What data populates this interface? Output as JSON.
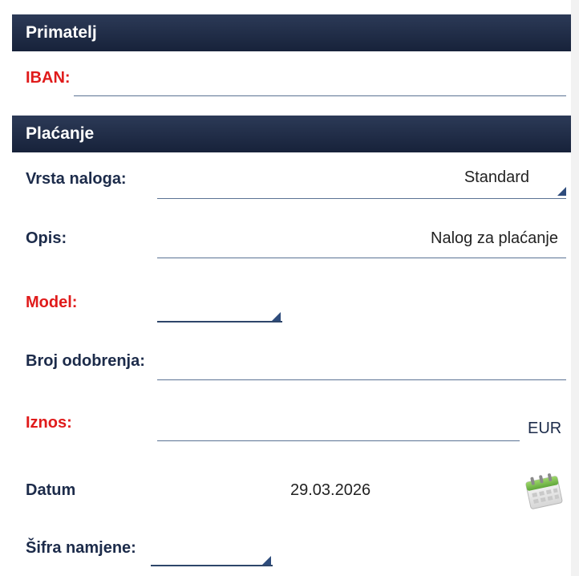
{
  "sections": {
    "primatelj_title": "Primatelj",
    "placanje_title": "Plaćanje"
  },
  "fields": {
    "iban": {
      "label": "IBAN:",
      "value": ""
    },
    "vrsta_naloga": {
      "label": "Vrsta naloga:",
      "value": "Standard"
    },
    "opis": {
      "label": "Opis:",
      "value": "Nalog za plaćanje"
    },
    "model": {
      "label": "Model:",
      "value": ""
    },
    "broj_odobrenja": {
      "label": "Broj odobrenja:",
      "value": ""
    },
    "iznos": {
      "label": "Iznos:",
      "value": "",
      "currency": "EUR"
    },
    "datum": {
      "label": "Datum",
      "value": "29.03.2026",
      "icon": "calendar-icon"
    },
    "sifra_namjene": {
      "label": "Šifra namjene:",
      "value": ""
    }
  },
  "colors": {
    "header_bg": "#1f2b45",
    "required_label": "#e01b1b",
    "label": "#1c2b4a",
    "underline": "#5b7394",
    "dropdown_marker": "#2e4c7c"
  }
}
